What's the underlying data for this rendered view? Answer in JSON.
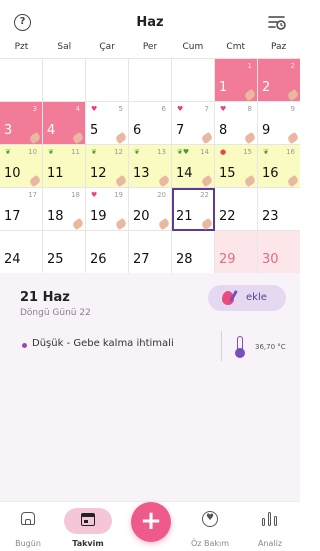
{
  "header": {
    "title": "Haz",
    "help_icon": "help-circle-icon",
    "settings_icon": "calendar-settings-icon"
  },
  "weekdays": [
    "Pzt",
    "Sal",
    "Çar",
    "Per",
    "Cum",
    "Cmt",
    "Paz"
  ],
  "calendar": {
    "weeks": [
      [
        {
          "day": "",
          "cycle": "",
          "type": "empty"
        },
        {
          "day": "",
          "cycle": "",
          "type": "empty"
        },
        {
          "day": "",
          "cycle": "",
          "type": "empty"
        },
        {
          "day": "",
          "cycle": "",
          "type": "empty"
        },
        {
          "day": "",
          "cycle": "",
          "type": "empty"
        },
        {
          "day": "1",
          "cycle": "1",
          "type": "period",
          "mark": "",
          "note": true
        },
        {
          "day": "2",
          "cycle": "2",
          "type": "period",
          "mark": "",
          "note": true
        }
      ],
      [
        {
          "day": "3",
          "cycle": "3",
          "type": "period",
          "mark": "",
          "note": true
        },
        {
          "day": "4",
          "cycle": "4",
          "type": "period",
          "mark": "",
          "note": true
        },
        {
          "day": "5",
          "cycle": "5",
          "type": "normal",
          "mark": "♥",
          "markType": "heart",
          "note": true
        },
        {
          "day": "6",
          "cycle": "6",
          "type": "normal",
          "mark": "",
          "note": false
        },
        {
          "day": "7",
          "cycle": "7",
          "type": "normal",
          "mark": "♥",
          "markType": "heart",
          "note": true
        },
        {
          "day": "8",
          "cycle": "8",
          "type": "normal",
          "mark": "♥",
          "markType": "heart",
          "note": true
        },
        {
          "day": "9",
          "cycle": "9",
          "type": "normal",
          "mark": "",
          "note": true
        }
      ],
      [
        {
          "day": "10",
          "cycle": "10",
          "type": "fertile",
          "mark": "❦",
          "markType": "sprout",
          "note": true
        },
        {
          "day": "11",
          "cycle": "11",
          "type": "fertile",
          "mark": "❦",
          "markType": "sprout",
          "note": false
        },
        {
          "day": "12",
          "cycle": "12",
          "type": "fertile",
          "mark": "❦",
          "markType": "sprout",
          "note": true
        },
        {
          "day": "13",
          "cycle": "13",
          "type": "fertile",
          "mark": "❦",
          "markType": "sprout",
          "note": true
        },
        {
          "day": "14",
          "cycle": "14",
          "type": "fertile",
          "mark": "❦♥",
          "markType": "sprout",
          "note": true
        },
        {
          "day": "15",
          "cycle": "15",
          "type": "fertile",
          "mark": "●",
          "markType": "dot",
          "note": true
        },
        {
          "day": "16",
          "cycle": "16",
          "type": "fertile",
          "mark": "❦",
          "markType": "sprout",
          "note": true
        }
      ],
      [
        {
          "day": "17",
          "cycle": "17",
          "type": "normal",
          "mark": "",
          "note": false
        },
        {
          "day": "18",
          "cycle": "18",
          "type": "normal",
          "mark": "",
          "note": true
        },
        {
          "day": "19",
          "cycle": "19",
          "type": "normal",
          "mark": "♥",
          "markType": "heart",
          "note": true
        },
        {
          "day": "20",
          "cycle": "20",
          "type": "normal",
          "mark": "",
          "note": true
        },
        {
          "day": "21",
          "cycle": "22",
          "type": "selected",
          "mark": "",
          "note": true
        },
        {
          "day": "22",
          "cycle": "",
          "type": "normal",
          "mark": "",
          "note": false
        },
        {
          "day": "23",
          "cycle": "",
          "type": "normal",
          "mark": "",
          "note": false
        }
      ],
      [
        {
          "day": "24",
          "cycle": "",
          "type": "normal",
          "mark": "",
          "note": false
        },
        {
          "day": "25",
          "cycle": "",
          "type": "normal",
          "mark": "",
          "note": false
        },
        {
          "day": "26",
          "cycle": "",
          "type": "normal",
          "mark": "",
          "note": false
        },
        {
          "day": "27",
          "cycle": "",
          "type": "normal",
          "mark": "",
          "note": false
        },
        {
          "day": "28",
          "cycle": "",
          "type": "normal",
          "mark": "",
          "note": false
        },
        {
          "day": "29",
          "cycle": "",
          "type": "predicted",
          "mark": "",
          "note": false
        },
        {
          "day": "30",
          "cycle": "",
          "type": "predicted",
          "mark": "",
          "note": false
        }
      ]
    ]
  },
  "detail": {
    "date": "21 Haz",
    "cycle_day": "Döngü Günü 22",
    "add_label": "ekle",
    "probability": "Düşük - Gebe kalma ihtimali",
    "temperature": "36,70 °C"
  },
  "nav": {
    "today": "Bugün",
    "calendar": "Takvim",
    "selfcare": "Öz Bakım",
    "analysis": "Analiz",
    "add": "+"
  },
  "colors": {
    "period": "#f27c97",
    "fertile": "#fafbc0",
    "predicted": "#fde6ea",
    "selected_border": "#5b3b96",
    "accent": "#ee5b8b"
  }
}
